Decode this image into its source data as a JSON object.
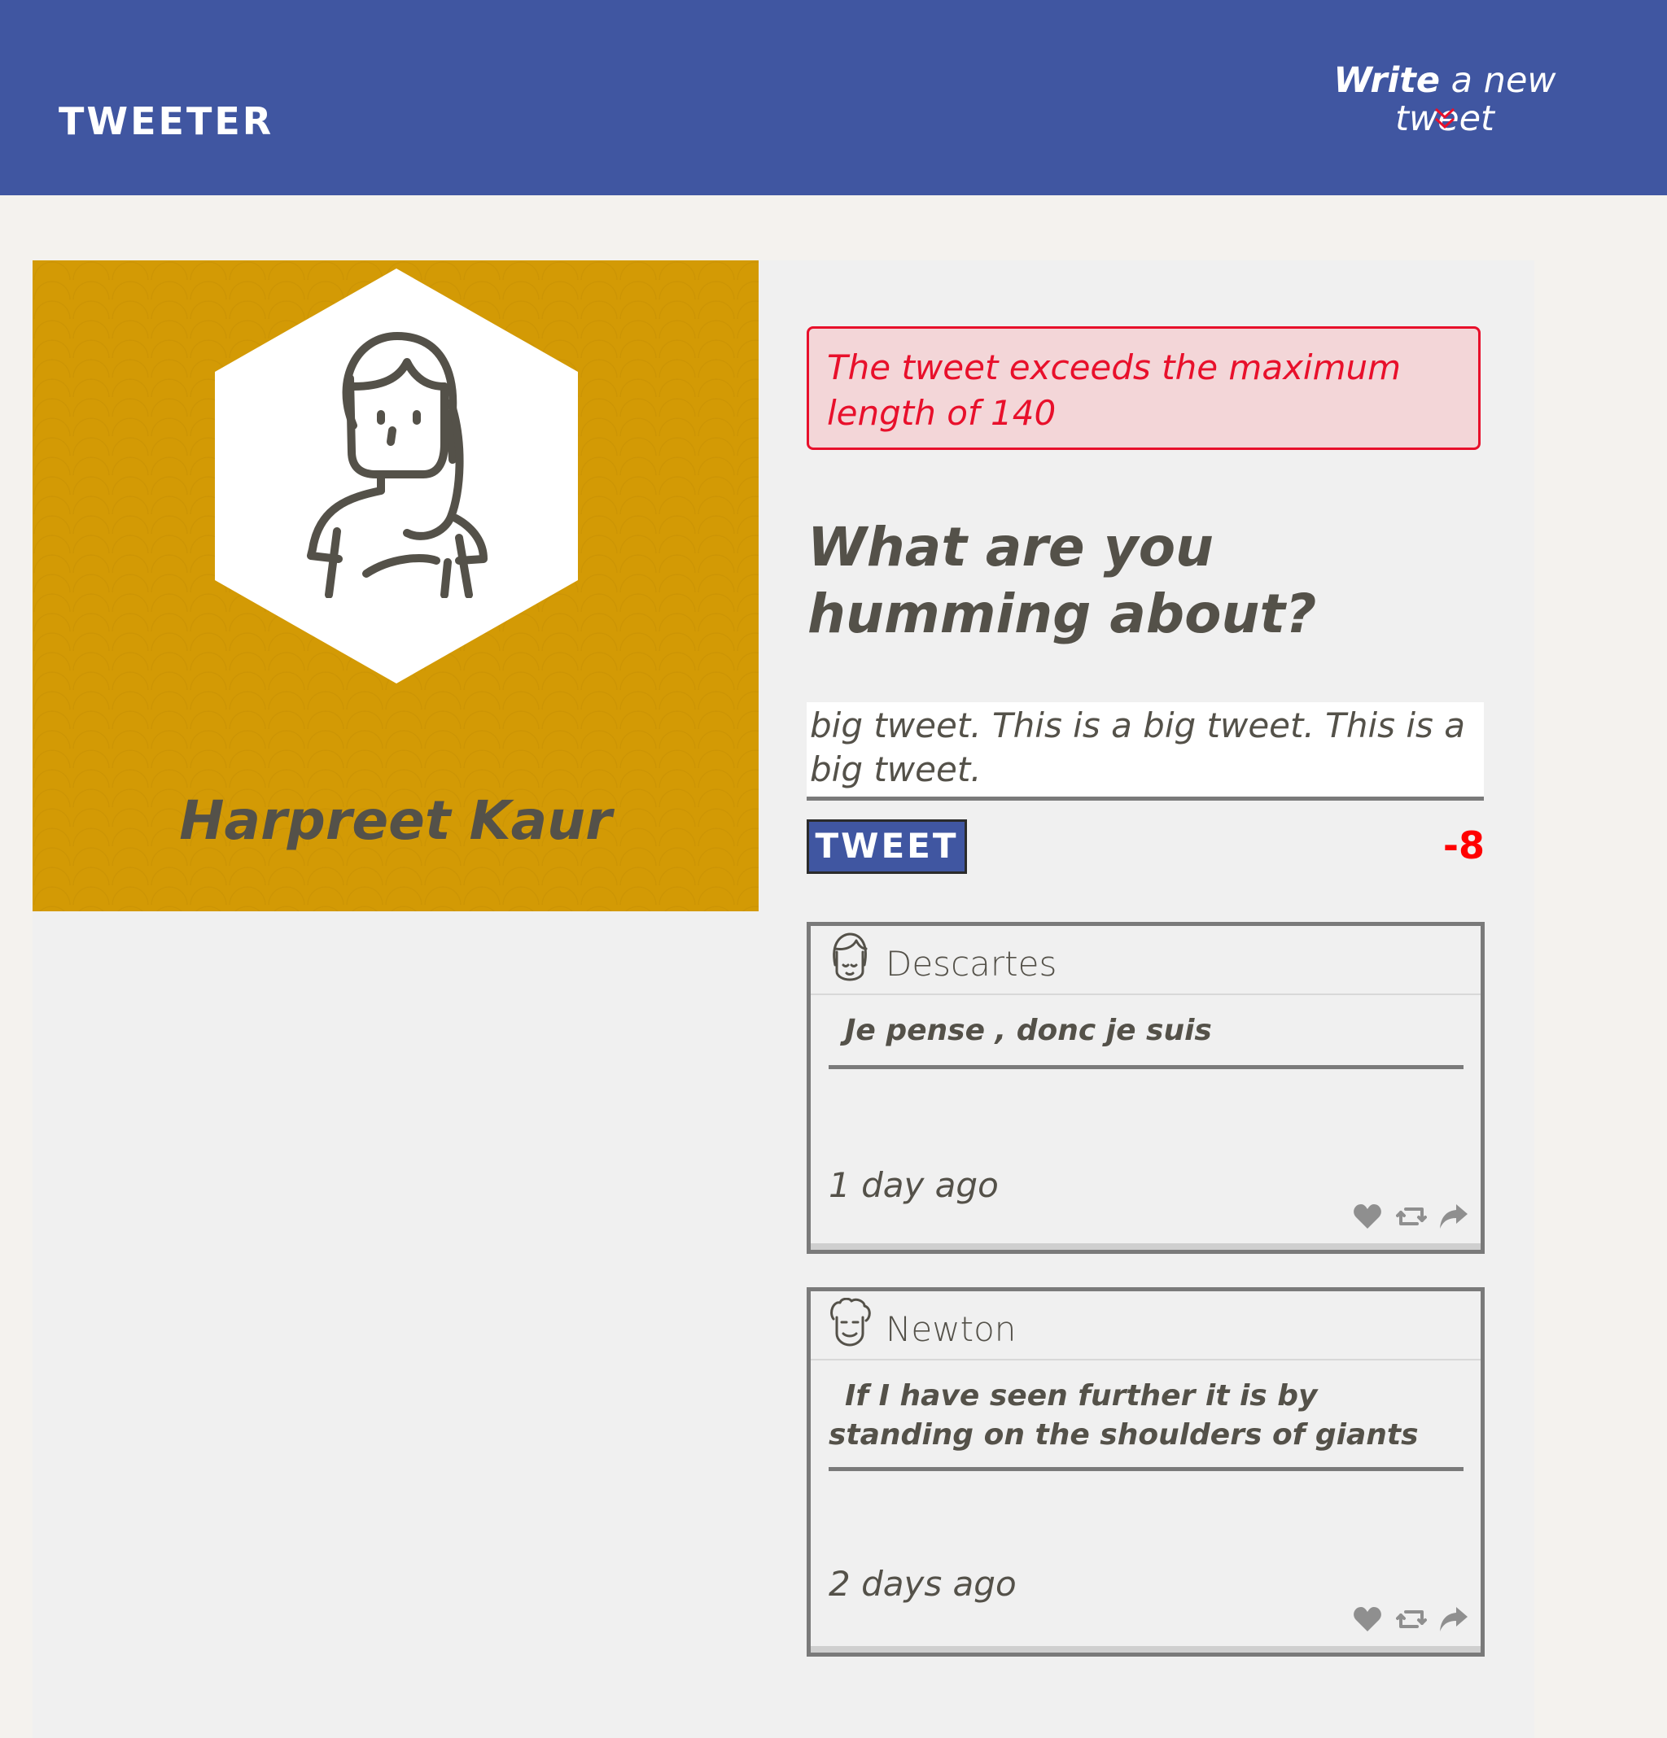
{
  "nav": {
    "brand": "TWEETER",
    "compose_toggle": {
      "strong": "Write",
      "light": " a new tweet"
    }
  },
  "profile": {
    "name": "Harpreet Kaur"
  },
  "compose": {
    "error": "The tweet exceeds the maximum length of 140",
    "title": "What are you humming about?",
    "textarea_value": "big tweet. This is a big tweet. This is a big tweet.",
    "button_label": "TWEET",
    "counter": "-8"
  },
  "tweets": [
    {
      "author": "Descartes",
      "text": "Je pense , donc je suis",
      "time": "1 day ago"
    },
    {
      "author": "Newton",
      "text": "If I have seen further it is by standing on the shoulders of giants",
      "time": "2 days ago"
    }
  ],
  "colors": {
    "nav": "#4056a1",
    "profile": "#d39a05",
    "error": "#e8102b",
    "counter": "#ff0000",
    "text": "#545149"
  },
  "icons": [
    "chevron-down-icon",
    "hexagon-frame",
    "avatar-icon",
    "heart-icon",
    "retweet-icon",
    "share-icon"
  ]
}
